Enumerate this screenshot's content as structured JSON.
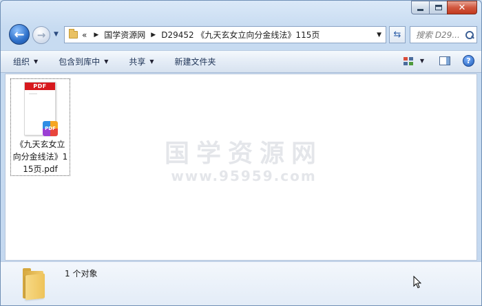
{
  "address_bar": {
    "overflow": "«",
    "crumbs": [
      "国学资源网",
      "D29452 《九天玄女立向分金线法》115页"
    ]
  },
  "search": {
    "placeholder": "搜索 D29..."
  },
  "toolbar": {
    "organize": "组织",
    "include_library": "包含到库中",
    "share": "共享",
    "new_folder": "新建文件夹"
  },
  "files": [
    {
      "name": "《九天玄女立向分金线法》115页.pdf",
      "type": "pdf",
      "band": "PDF",
      "badge": "PDF"
    }
  ],
  "watermark": {
    "line1": "国学资源网",
    "line2": "www.95959.com"
  },
  "details": {
    "status": "1 个对象"
  },
  "icons": {
    "back": "arrow-left-icon",
    "forward": "arrow-right-icon",
    "refresh": "refresh-icon",
    "search": "search-icon",
    "views": "views-icon",
    "preview": "preview-pane-icon",
    "help": "help-icon"
  }
}
